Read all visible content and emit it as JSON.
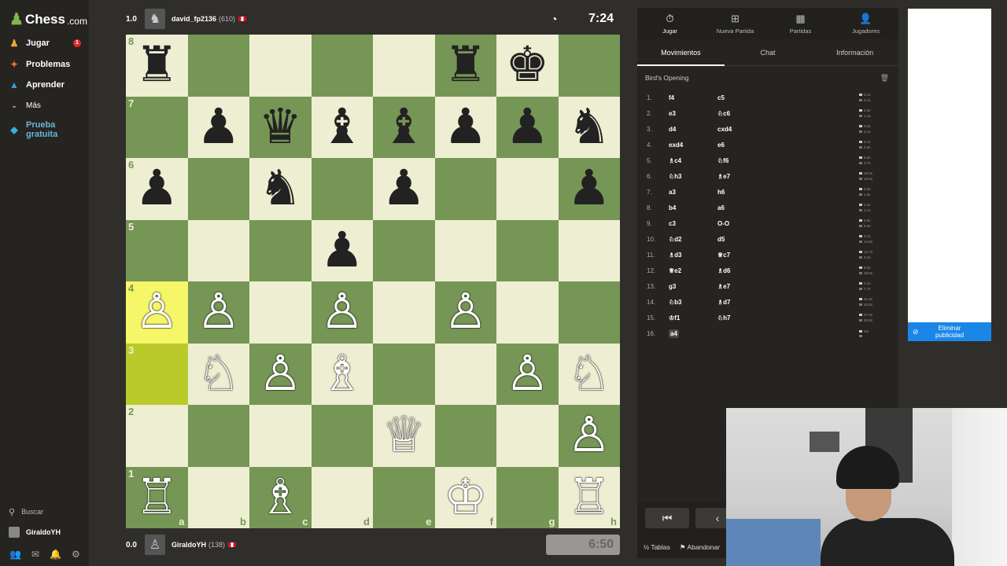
{
  "sidebar": {
    "logo_text": "Chess",
    "logo_suffix": ".com",
    "items": [
      {
        "label": "Jugar",
        "icon": "pawn-icon",
        "badge": "1"
      },
      {
        "label": "Problemas",
        "icon": "puzzle-icon"
      },
      {
        "label": "Aprender",
        "icon": "learn-icon"
      },
      {
        "label": "Más",
        "icon": "chevron-down-icon"
      }
    ],
    "trial_label_1": "Prueba",
    "trial_label_2": "gratuita",
    "search_label": "Buscar",
    "username": "GiraldoYH"
  },
  "top_player": {
    "score": "1.0",
    "name": "david_fp2136",
    "rating": "(610)",
    "clock": "7:24"
  },
  "bottom_player": {
    "score": "0.0",
    "name": "GiraldoYH",
    "rating": "(138)",
    "clock": "6:50"
  },
  "board": {
    "ranks": [
      "8",
      "7",
      "6",
      "5",
      "4",
      "3",
      "2",
      "1"
    ],
    "files": [
      "a",
      "b",
      "c",
      "d",
      "e",
      "f",
      "g",
      "h"
    ],
    "position": [
      [
        "bR",
        "",
        "",
        "",
        "",
        "bR",
        "bK",
        ""
      ],
      [
        "",
        "bP",
        "bQ",
        "bB",
        "bB",
        "bP",
        "bP",
        "bN"
      ],
      [
        "bP",
        "",
        "bN",
        "",
        "bP",
        "",
        "",
        "bP"
      ],
      [
        "",
        "",
        "",
        "bP",
        "",
        "",
        "",
        ""
      ],
      [
        "wP",
        "wP",
        "",
        "wP",
        "",
        "wP",
        "",
        ""
      ],
      [
        "",
        "wN",
        "wP",
        "wB",
        "",
        "",
        "wP",
        "wN"
      ],
      [
        "",
        "",
        "",
        "",
        "wQ",
        "",
        "",
        "wP"
      ],
      [
        "wR",
        "",
        "wB",
        "",
        "",
        "wK",
        "",
        "wR"
      ]
    ],
    "highlight": [
      "a4",
      "a3"
    ]
  },
  "panel": {
    "topnav": [
      {
        "label": "Jugar",
        "icon": "clock-icon"
      },
      {
        "label": "Nueva Partida",
        "icon": "plus-icon"
      },
      {
        "label": "Partidas",
        "icon": "board-icon"
      },
      {
        "label": "Jugadores",
        "icon": "players-icon"
      }
    ],
    "tabs": [
      "Movimientos",
      "Chat",
      "Información"
    ],
    "opening": "Bird's Opening",
    "moves": [
      {
        "n": "1.",
        "w": "f4",
        "b": "c5",
        "wt": "0.1s",
        "bt": "0.1s"
      },
      {
        "n": "2.",
        "w": "e3",
        "b": "♘c6",
        "wt": "6.3s",
        "bt": "1.1s"
      },
      {
        "n": "3.",
        "w": "d4",
        "b": "cxd4",
        "wt": "3.4s",
        "bt": "2.1s"
      },
      {
        "n": "4.",
        "w": "exd4",
        "b": "e6",
        "wt": "3.1s",
        "bt": "5.6s"
      },
      {
        "n": "5.",
        "w": "♗c4",
        "b": "♘f6",
        "wt": "8.3s",
        "bt": "2.7s"
      },
      {
        "n": "6.",
        "w": "♘h3",
        "b": "♗e7",
        "wt": "15.0s",
        "bt": "15.5s"
      },
      {
        "n": "7.",
        "w": "a3",
        "b": "h6",
        "wt": "6.6s",
        "bt": "1.6s"
      },
      {
        "n": "8.",
        "w": "b4",
        "b": "a6",
        "wt": "1.2s",
        "bt": "2.1s"
      },
      {
        "n": "9.",
        "w": "c3",
        "b": "O-O",
        "wt": "8.9s",
        "bt": "5.6s"
      },
      {
        "n": "10.",
        "w": "♘d2",
        "b": "d5",
        "wt": "3.7s",
        "bt": "14.9s"
      },
      {
        "n": "11.",
        "w": "♗d3",
        "b": "♕c7",
        "wt": "12.7s",
        "bt": "3.4s"
      },
      {
        "n": "12.",
        "w": "♕e2",
        "b": "♗d6",
        "wt": "8.0s",
        "bt": "18.9s"
      },
      {
        "n": "13.",
        "w": "g3",
        "b": "♗e7",
        "wt": "2.1s",
        "bt": "7.7s"
      },
      {
        "n": "14.",
        "w": "♘b3",
        "b": "♗d7",
        "wt": "31.6s",
        "bt": "34.5s"
      },
      {
        "n": "15.",
        "w": "♔f1",
        "b": "♘h7",
        "wt": "27.2s",
        "bt": "30.9s"
      },
      {
        "n": "16.",
        "w": "a4",
        "b": "",
        "wt": "1m",
        "bt": ""
      }
    ],
    "actions": {
      "draw": "Tablas",
      "resign": "Abandonar"
    }
  },
  "ad": {
    "remove_line1": "Eliminar",
    "remove_line2": "publicidad"
  },
  "colors": {
    "accent": "#81b64c",
    "light_square": "#eeeed2",
    "dark_square": "#769656",
    "highlight": "#f6f669",
    "ad_button": "#1a87e8"
  }
}
